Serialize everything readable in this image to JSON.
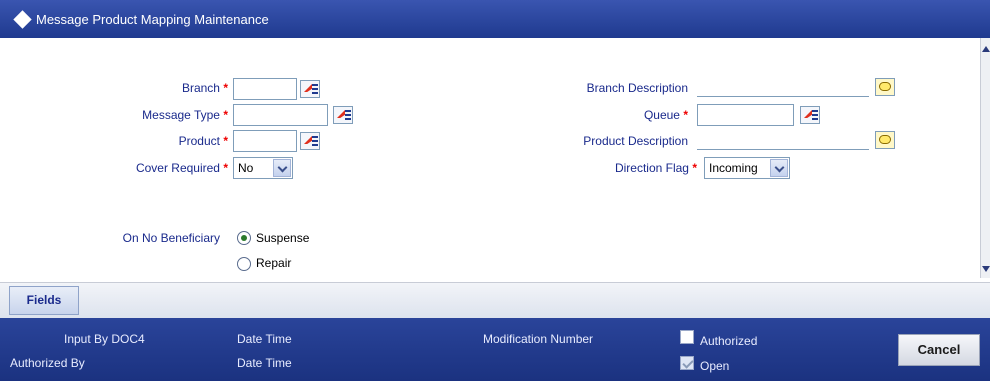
{
  "window": {
    "title": "Message Product Mapping Maintenance"
  },
  "form": {
    "branch_label": "Branch",
    "message_type_label": "Message Type",
    "product_label": "Product",
    "cover_required_label": "Cover Required",
    "cover_required_value": "No",
    "branch_description_label": "Branch Description",
    "queue_label": "Queue",
    "product_description_label": "Product Description",
    "direction_flag_label": "Direction Flag",
    "direction_flag_value": "Incoming",
    "required_marker": "*",
    "on_no_beneficiary_label": "On No Beneficiary",
    "radio_suspense": "Suspense",
    "radio_repair": "Repair"
  },
  "tabs": {
    "fields": "Fields"
  },
  "footer": {
    "input_by": "Input By DOC4",
    "date_time_1": "Date Time",
    "authorized_by": "Authorized By",
    "date_time_2": "Date Time",
    "modification_number": "Modification Number",
    "authorized": "Authorized",
    "open": "Open",
    "cancel": "Cancel"
  },
  "icons": {
    "lov": "list-of-values-icon",
    "note": "comment-bubble-icon",
    "dropdown": "chevron-down-icon"
  }
}
